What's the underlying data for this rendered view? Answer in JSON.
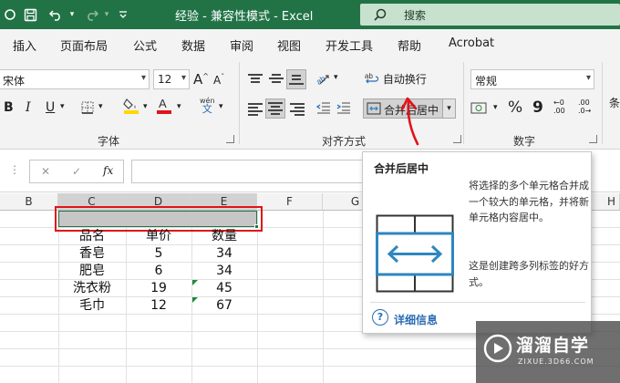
{
  "window": {
    "title": "经验  -  兼容性模式  -  Excel",
    "search_placeholder": "搜索"
  },
  "colors": {
    "titlebar": "#217346",
    "searchbox": "#c8e1cf",
    "annotation_red": "#e0131a",
    "highlight_yellow": "#ffd800",
    "font_color_red": "#e0131a",
    "link_blue": "#2b6cb5",
    "merge_icon_blue": "#2e86c1"
  },
  "menu": {
    "tabs": [
      "插入",
      "页面布局",
      "公式",
      "数据",
      "审阅",
      "视图",
      "开发工具",
      "帮助",
      "Acrobat"
    ]
  },
  "ribbon": {
    "font": {
      "font_name": "宋体",
      "font_size": "12",
      "grow_font": "A",
      "shrink_font": "A",
      "bold": "B",
      "italic": "I",
      "underline": "U",
      "phonetic": "wén",
      "group_label": "字体"
    },
    "alignment": {
      "wrap_text_label": "自动换行",
      "merge_center_label": "合并后居中",
      "group_label": "对齐方式"
    },
    "number": {
      "format": "常规",
      "percent": "%",
      "comma": "9",
      "group_label": "数字",
      "inc_decimal": ".00",
      "dec_decimal": ".0"
    },
    "cutoff": "条"
  },
  "formula_bar": {
    "fx": "fx",
    "cancel": "✕",
    "enter": "✓",
    "dots": "⋮"
  },
  "sheet": {
    "columns": [
      "B",
      "C",
      "D",
      "E",
      "F",
      "G",
      "H"
    ],
    "headers": [
      "品名",
      "单价",
      "数量"
    ],
    "rows": [
      [
        "香皂",
        "5",
        "34"
      ],
      [
        "肥皂",
        "6",
        "34"
      ],
      [
        "洗衣粉",
        "19",
        "45"
      ],
      [
        "毛巾",
        "12",
        "67"
      ]
    ]
  },
  "tooltip": {
    "title": "合并后居中",
    "description": "将选择的多个单元格合并成一个较大的单元格，并将新单元格内容居中。",
    "description2": "这是创建跨多列标签的好方式。",
    "more_info": "详细信息",
    "help_icon": "?"
  },
  "watermark": {
    "name": "溜溜自学",
    "url": "ZIXUE.3D66.COM"
  }
}
